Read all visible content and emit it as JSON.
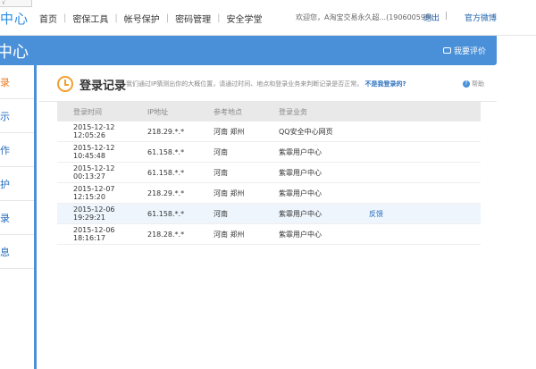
{
  "topnav": {
    "corner": "√",
    "brand": "中心",
    "links": [
      "首页",
      "密保工具",
      "帐号保护",
      "密码管理",
      "安全学堂"
    ],
    "welcome": "欢迎您，A淘宝交易永久超...(190600599)",
    "logout": "退出",
    "separator": "|",
    "weibo": "官方微博"
  },
  "header": {
    "title": "中心",
    "review": "我要评价"
  },
  "sidebar": {
    "items": [
      "录",
      "示",
      "作",
      "护",
      "录",
      "息"
    ]
  },
  "panel": {
    "title": "登录记录",
    "description": "我们通过IP猜测出你的大概位置，请通过时间、地点和登录业务来判断记录是否正常。",
    "question": "不是我登录的?",
    "help": "帮助"
  },
  "table": {
    "columns": [
      "登录时间",
      "IP地址",
      "参考地点",
      "登录业务"
    ],
    "rows": [
      {
        "time": "2015-12-12 12:05:26",
        "ip": "218.29.*.*",
        "place": "河南 郑州",
        "service": "QQ安全中心网页",
        "action": ""
      },
      {
        "time": "2015-12-12 10:45:48",
        "ip": "61.158.*.*",
        "place": "河南",
        "service": "紫霏用户中心",
        "action": ""
      },
      {
        "time": "2015-12-12 00:13:27",
        "ip": "61.158.*.*",
        "place": "河南",
        "service": "紫霏用户中心",
        "action": ""
      },
      {
        "time": "2015-12-07 12:15:20",
        "ip": "218.29.*.*",
        "place": "河南 郑州",
        "service": "紫霏用户中心",
        "action": ""
      },
      {
        "time": "2015-12-06 19:29:21",
        "ip": "61.158.*.*",
        "place": "河南",
        "service": "紫霏用户中心",
        "action": "反馈"
      },
      {
        "time": "2015-12-06 18:16:17",
        "ip": "218.28.*.*",
        "place": "河南 郑州",
        "service": "紫霏用户中心",
        "action": ""
      }
    ]
  },
  "colors": {
    "accent": "#4a90d9",
    "active": "#ef7d22",
    "link": "#2a6fbd"
  }
}
